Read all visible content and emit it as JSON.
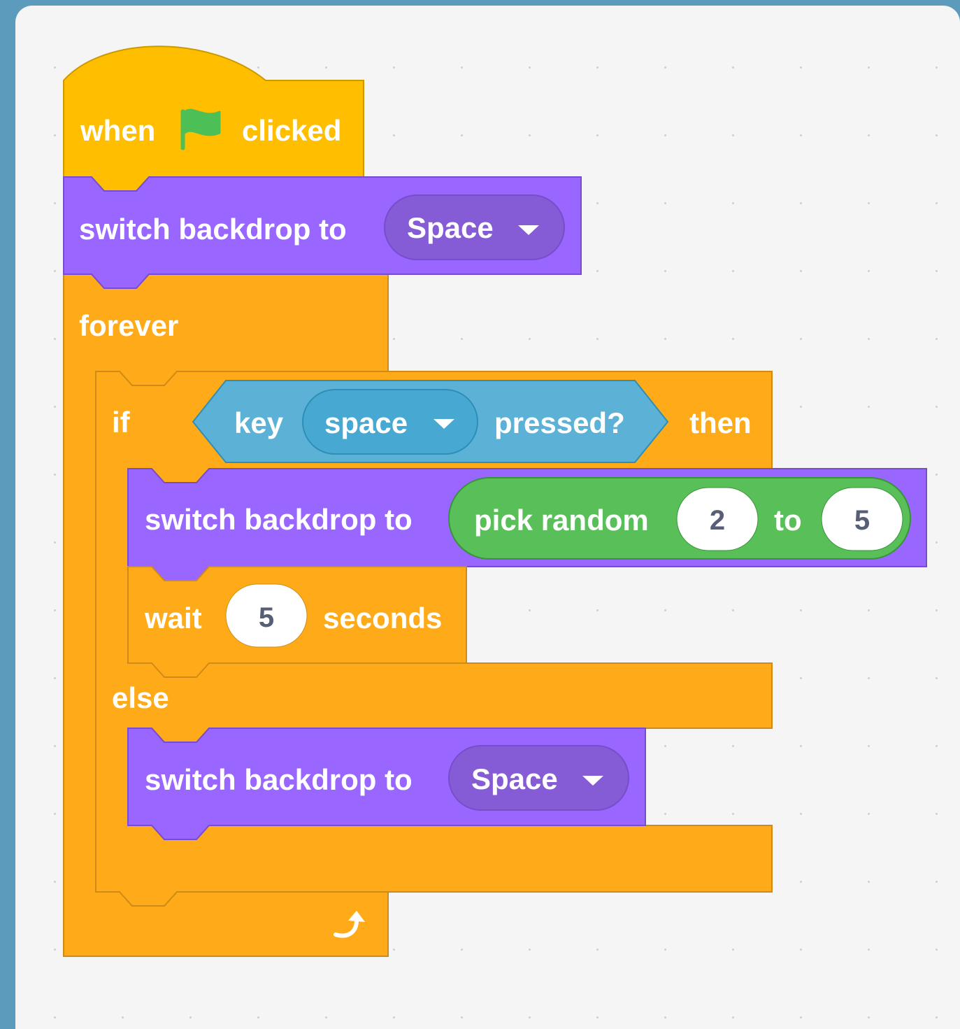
{
  "colors": {
    "events": "#ffbf00",
    "looks": "#9966ff",
    "looks_menu": "#855cd6",
    "control": "#ffab19",
    "sensing": "#5cb1d6",
    "sensing_menu": "#47a8d1",
    "operators": "#59c059",
    "flag": "#4cbf56",
    "number_text": "#575e75"
  },
  "script": {
    "hat": {
      "when_label": "when",
      "flag_icon": "green-flag-icon",
      "clicked_label": "clicked"
    },
    "switch_backdrop_1": {
      "label": "switch backdrop to",
      "value": "Space"
    },
    "forever": {
      "label": "forever",
      "loop_icon": "loop-arrow-icon"
    },
    "if_else": {
      "if_label": "if",
      "then_label": "then",
      "else_label": "else",
      "condition": {
        "key_label": "key",
        "key_value": "space",
        "pressed_label": "pressed?"
      }
    },
    "switch_backdrop_2": {
      "label": "switch backdrop to",
      "pick_random": {
        "label": "pick random",
        "from": "2",
        "to_label": "to",
        "to": "5"
      }
    },
    "wait": {
      "label": "wait",
      "value": "5",
      "unit": "seconds"
    },
    "switch_backdrop_3": {
      "label": "switch backdrop to",
      "value": "Space"
    }
  }
}
